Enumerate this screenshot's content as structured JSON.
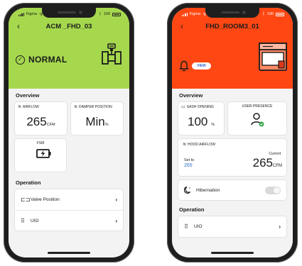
{
  "left_phone": {
    "status_bar": {
      "carrier": "Figma",
      "battery": "100"
    },
    "header": {
      "title": "ACM _FHD_03",
      "status": "NORMAL",
      "bg_color": "#a6d84e"
    },
    "overview": {
      "title": "Overview",
      "airflow": {
        "label": "AIRFLOW",
        "value": "265",
        "unit": "CFM"
      },
      "damper": {
        "label": "DAMPER POSITION",
        "value": "Min",
        "unit": "%"
      },
      "fsm": {
        "label": "FSM"
      }
    },
    "operation": {
      "title": "Operation",
      "items": [
        {
          "label": "Valve Position",
          "icon": "valve-icon"
        },
        {
          "label": "UIO",
          "icon": "grid-icon"
        }
      ]
    }
  },
  "right_phone": {
    "status_bar": {
      "carrier": "Figma",
      "battery": "100"
    },
    "header": {
      "title": "FHD_ROOM3_01",
      "view_label": "VIEW",
      "bg_color": "#ff4713"
    },
    "overview": {
      "title": "Overview",
      "sash": {
        "label": "SASH OPENING",
        "value": "100",
        "unit": "%"
      },
      "presence": {
        "label": "USER PRESENCE"
      },
      "hood": {
        "label": "HOOD AIRFLOW",
        "set_label": "Set to",
        "set_value": "265",
        "current_label": "Current",
        "current_value": "265",
        "unit": "CFM"
      },
      "hibernation": {
        "label": "Hibernation",
        "on": false
      }
    },
    "operation": {
      "title": "Operation",
      "items": [
        {
          "label": "UIO",
          "icon": "grid-icon"
        }
      ]
    }
  }
}
